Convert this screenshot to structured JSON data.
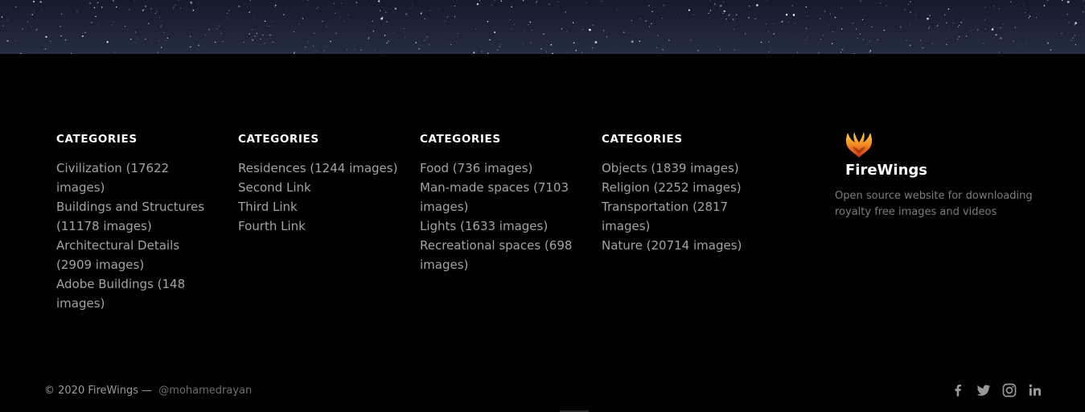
{
  "footer": {
    "columns": [
      {
        "title": "CATEGORIES",
        "links": [
          "Civilization (17622 images)",
          "Buildings and Structures (11178 images)",
          "Architectural Details (2909 images)",
          "Adobe Buildings (148 images)"
        ]
      },
      {
        "title": "CATEGORIES",
        "links": [
          "Residences (1244 images)",
          "Second Link",
          "Third Link",
          "Fourth Link"
        ]
      },
      {
        "title": "CATEGORIES",
        "links": [
          "Food (736 images)",
          "Man-made spaces (7103 images)",
          "Lights (1633 images)",
          "Recreational spaces (698 images)"
        ]
      },
      {
        "title": "CATEGORIES",
        "links": [
          "Objects (1839 images)",
          "Religion (2252 images)",
          "Transportation (2817 images)",
          "Nature (20714 images)"
        ]
      }
    ],
    "brand": {
      "name": "FireWings",
      "description": "Open source website for downloading royalty free images and videos",
      "logo_icon": "phoenix-wings-logo"
    },
    "copyright": "© 2020 FireWings —",
    "author": "@mohamedrayan",
    "social": [
      {
        "name": "facebook-icon"
      },
      {
        "name": "twitter-icon"
      },
      {
        "name": "instagram-icon"
      },
      {
        "name": "linkedin-icon"
      }
    ],
    "colors": {
      "background": "#010101",
      "title": "#ffffff",
      "link": "#a3a3a3",
      "muted": "#7c7c7c",
      "icon": "#9a9a9a"
    }
  }
}
